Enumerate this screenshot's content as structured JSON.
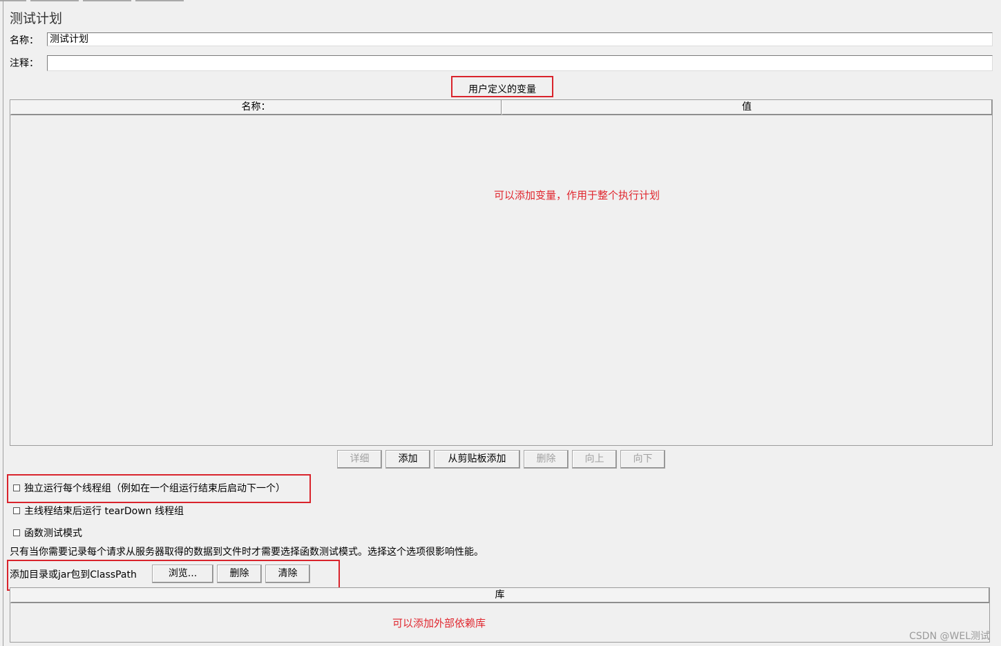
{
  "panel": {
    "title": "测试计划",
    "name_label": "名称：",
    "name_value": "测试计划",
    "comment_label": "注释：",
    "comment_value": ""
  },
  "variables": {
    "section_title": "用户定义的变量",
    "columns": [
      "名称：",
      "值"
    ],
    "annotation": "可以添加变量，作用于整个执行计划",
    "buttons": {
      "detail": "详细",
      "add": "添加",
      "add_clipboard": "从剪贴板添加",
      "delete": "删除",
      "up": "向上",
      "down": "向下"
    }
  },
  "options": {
    "serialize_threadgroups": "独立运行每个线程组（例如在一个组运行结束后启动下一个）",
    "teardown_on_shutdown": "主线程结束后运行 tearDown 线程组",
    "functional_mode": "函数测试模式",
    "functional_mode_note": "只有当你需要记录每个请求从服务器取得的数据到文件时才需要选择函数测试模式。选择这个选项很影响性能。"
  },
  "classpath": {
    "label": "添加目录或jar包到ClassPath",
    "browse": "浏览...",
    "delete": "删除",
    "clear": "清除",
    "library_column": "库",
    "annotation": "可以添加外部依赖库"
  },
  "watermark": "CSDN @WEL测试",
  "colors": {
    "background": "#f0f0f0",
    "highlight_red": "#d9232b",
    "annotation_red": "#e0262e"
  }
}
